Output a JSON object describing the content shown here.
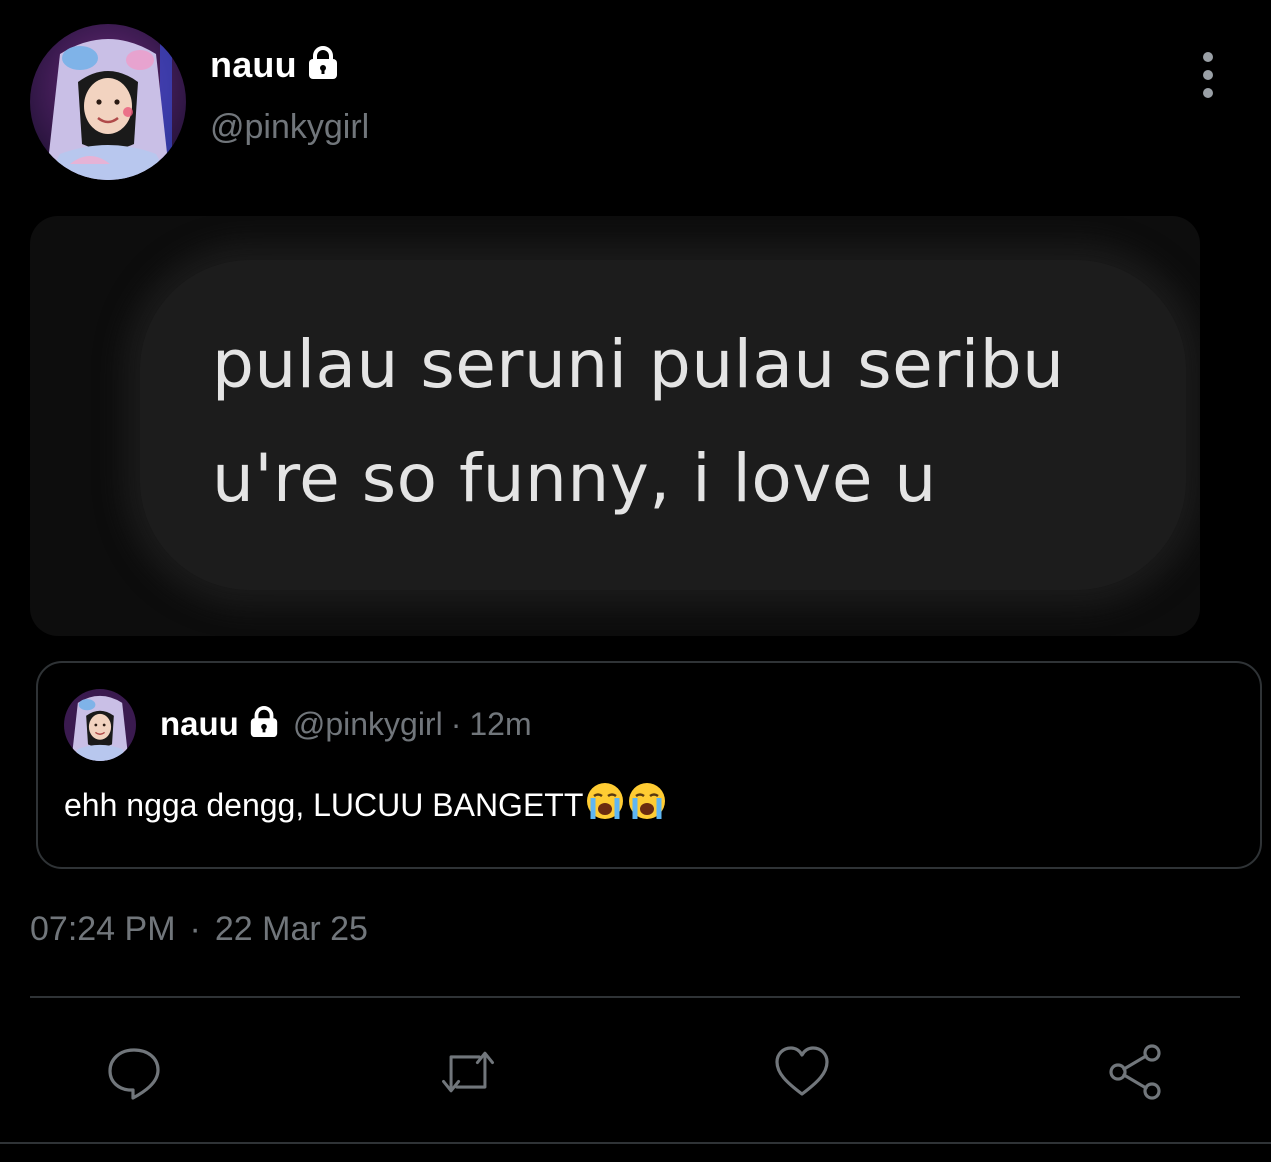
{
  "author": {
    "display_name": "nauu",
    "handle": "@pinkygirl",
    "avatar_icon": "profile-photo-pink-hoodie",
    "locked_icon": "lock-icon"
  },
  "media": {
    "text_line_1": "pulau seruni pulau seribu",
    "text_line_2": "u're so funny, i love u"
  },
  "quoted_tweet": {
    "display_name": "nauu",
    "handle": "@pinkygirl",
    "separator": "·",
    "time": "12m",
    "text": "ehh ngga dengg, LUCUU BANGETT",
    "emojis": [
      "loudly-crying-face",
      "loudly-crying-face"
    ]
  },
  "timestamp": {
    "time": "07:24 PM",
    "separator": "·",
    "date": "22 Mar 25"
  },
  "actions": {
    "reply_icon": "reply-icon",
    "retweet_icon": "retweet-icon",
    "like_icon": "heart-icon",
    "share_icon": "share-icon"
  },
  "colors": {
    "background": "#000000",
    "secondary_text": "#71767b",
    "border": "#2f3336"
  }
}
